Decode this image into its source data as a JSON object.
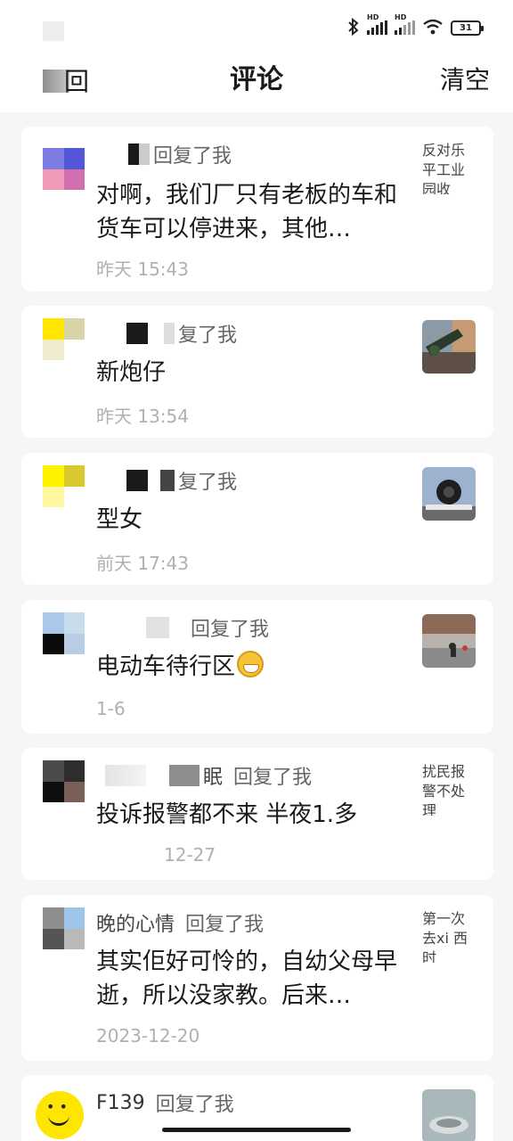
{
  "status_bar": {
    "bluetooth_icon": "bluetooth-icon",
    "signal1_label": "HD",
    "signal2_label": "HD",
    "wifi_icon": "wifi-icon",
    "battery": "31"
  },
  "header": {
    "back_label": "回",
    "title": "评论",
    "clear_label": "清空"
  },
  "comments": [
    {
      "avatar_colors": [
        "#7b7be0",
        "#5456d8",
        "#f09bb9",
        "#d070b0"
      ],
      "name": "",
      "reply": "回复了我",
      "text": "对啊，我们厂只有老板的车和货车可以停进来，其他…",
      "time": "昨天 15:43",
      "ref_text": "反对乐平工业园收"
    },
    {
      "avatar_colors": [
        "#ffe500",
        "#d8d4a8",
        "#f0ecd0",
        "#ffffff"
      ],
      "name": "",
      "reply": "复了我",
      "text": "新炮仔",
      "time": "昨天 13:54",
      "ref_text": ""
    },
    {
      "avatar_colors": [
        "#fff200",
        "#d9c830",
        "#fff6a0",
        "#fff"
      ],
      "name": "",
      "reply": "复了我",
      "text": "型女",
      "time": "前天 17:43",
      "ref_text": ""
    },
    {
      "avatar_colors": [
        "#a9c8ea",
        "#c9dcee",
        "#0b0b0b",
        "#b8cde3"
      ],
      "name": "",
      "reply": "回复了我",
      "text": "电动车待行区",
      "time": "1-6",
      "ref_text": ""
    },
    {
      "avatar_colors": [
        "#4a4a4a",
        "#2e2e2e",
        "#0e0e0e",
        "#7a5e58"
      ],
      "name": "眠",
      "reply": "回复了我",
      "text": "投诉报警都不来 半夜1.多",
      "time": "12-27",
      "ref_text": "扰民报警不处理"
    },
    {
      "avatar_colors": [
        "#8e8e8e",
        "#9ec4ea",
        "#555555",
        "#b9b9b9"
      ],
      "name": "晚的心情",
      "reply": "回复了我",
      "text": "其实佢好可怜的，自幼父母早逝，所以没家教。后来…",
      "time": "2023-12-20",
      "ref_text": "第一次去xi 西时"
    },
    {
      "avatar_colors": [],
      "name": "F139",
      "reply": "回复了我",
      "text": "",
      "time": "",
      "ref_text": ""
    }
  ]
}
